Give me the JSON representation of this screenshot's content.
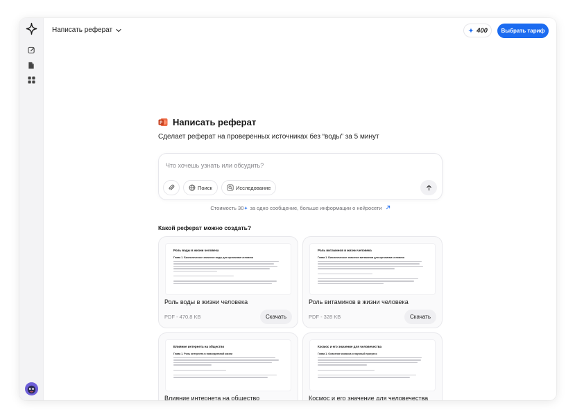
{
  "header": {
    "title": "Написать реферат",
    "credits": "400",
    "plan_button": "Выбрать тариф"
  },
  "sidebar": {
    "items": [
      {
        "icon": "new-chat-icon"
      },
      {
        "icon": "document-icon"
      },
      {
        "icon": "apps-grid-icon"
      }
    ]
  },
  "main": {
    "title": "Написать реферат",
    "subtitle": "Сделает реферат на проверенных источниках без “воды” за 5 минут",
    "prompt": {
      "placeholder": "Что хочешь узнать или обсудить?",
      "search_label": "Поиск",
      "research_label": "Исследование"
    },
    "cost": {
      "prefix": "Стоимость",
      "amount": "30",
      "suffix": "за одно сообщение, больше информации о нейросети"
    },
    "section_title": "Какой реферат можно создать?",
    "cards": [
      {
        "preview_title": "Роль воды в жизни человека",
        "preview_chapter": "Глава 1. Биологическое значение воды для организма человека",
        "title": "Роль воды в жизни человека",
        "meta": "PDF - 470.8 KB",
        "button": "Скачать"
      },
      {
        "preview_title": "Роль витаминов в жизни человека",
        "preview_chapter": "Глава 1. Биологическое значение витаминов для организма человека",
        "title": "Роль витаминов в жизни человека",
        "meta": "PDF - 328 KB",
        "button": "Скачать"
      },
      {
        "preview_title": "Влияние интернета на общество",
        "preview_chapter": "Глава 1. Роль интернета в повседневной жизни",
        "title": "Влияние интернета на общество",
        "meta": "",
        "button": ""
      },
      {
        "preview_title": "Космос и его значение для человечества",
        "preview_chapter": "Глава 1. Освоение космоса и научный прогресс",
        "title": "Космос и его значение для человечества",
        "meta": "",
        "button": ""
      }
    ]
  },
  "colors": {
    "accent": "#1b6bf0",
    "sidebar_bg": "#f3f3f5",
    "card_bg": "#fafafb"
  }
}
